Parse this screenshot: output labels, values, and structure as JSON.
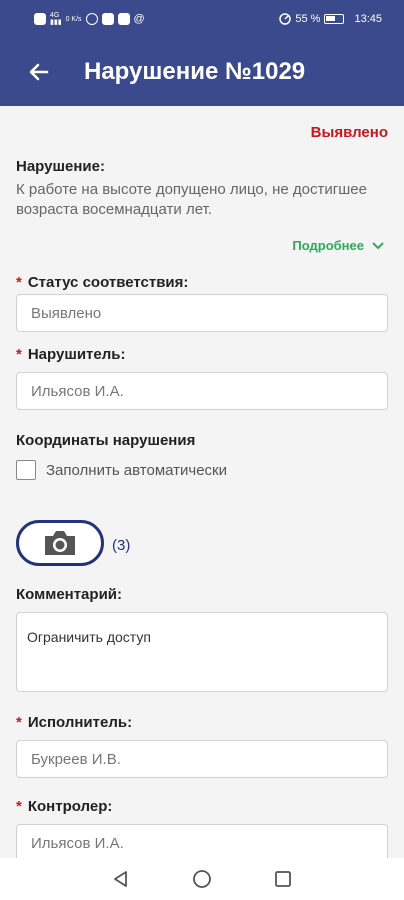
{
  "statusbar": {
    "left_icons": [
      "nfc-icon",
      "signal-4g-icon",
      "data-rate-icon",
      "viber-icon",
      "messenger-icon",
      "app-icon",
      "at-icon"
    ],
    "data_rate": "0 K/s",
    "battery_percent": "55 %",
    "time": "13:45"
  },
  "appbar": {
    "title": "Нарушение №1029",
    "background": "#3b4a8c"
  },
  "violation": {
    "status_text": "Выявлено",
    "label": "Нарушение:",
    "description": "К работе на высоте допущено лицо, не достигшее возраста восемнадцати лет.",
    "more_label": "Подробнее"
  },
  "compliance_status": {
    "label": "Статус соответствия:",
    "value": "Выявлено"
  },
  "violator": {
    "label": "Нарушитель:",
    "value": "Ильясов И.А."
  },
  "coordinates": {
    "label": "Координаты нарушения",
    "auto_fill_label": "Заполнить автоматически"
  },
  "photos": {
    "count_text": "(3)"
  },
  "comment": {
    "label": "Комментарий:",
    "value": "Ограничить доступ"
  },
  "executor": {
    "label": "Исполнитель:",
    "value": "Букреев И.В."
  },
  "controller": {
    "label": "Контролер:",
    "value": "Ильясов И.А."
  },
  "colors": {
    "accent": "#3b4a8c",
    "required": "#c8161e",
    "link": "#2eaa5c",
    "camera_border": "#24327a"
  }
}
